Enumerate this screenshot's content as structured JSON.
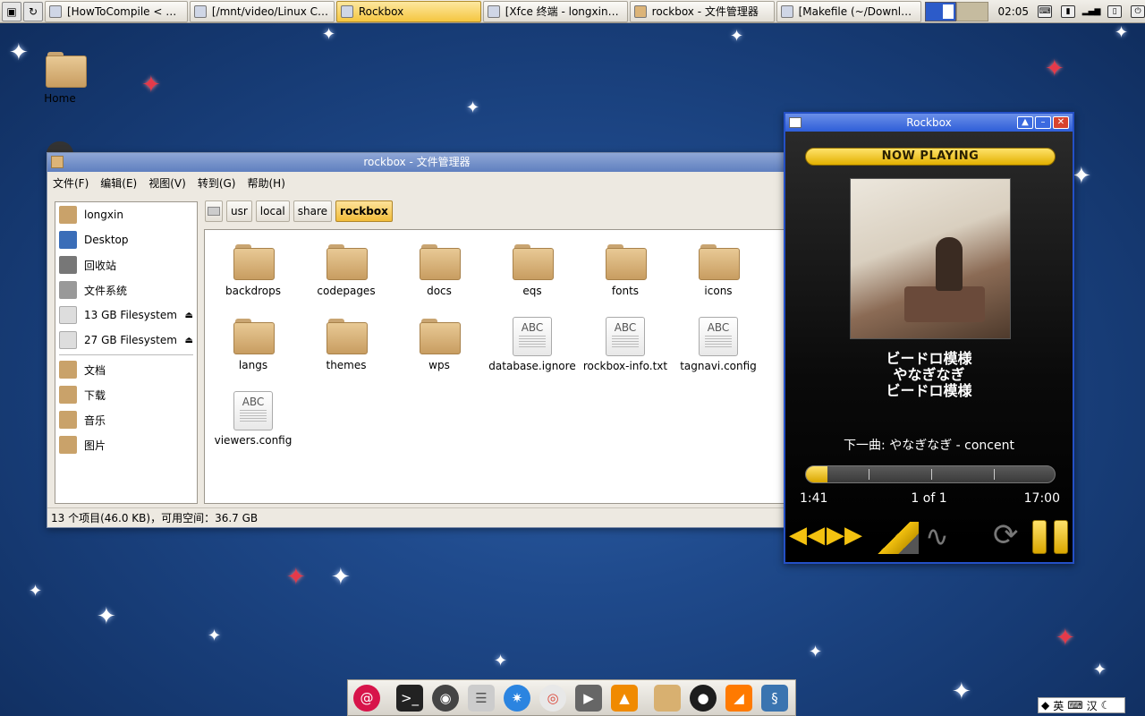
{
  "taskbar": {
    "launchers": [
      "monitor-icon",
      "reload-icon"
    ],
    "tasks": [
      {
        "label": "[HowToCompile < Ma…",
        "icon": "chrome-icon",
        "active": false
      },
      {
        "label": "[/mnt/video/Linux C…",
        "icon": "browser-icon",
        "active": false
      },
      {
        "label": "Rockbox",
        "icon": "window-icon",
        "active": true
      },
      {
        "label": "[Xfce 终端 - longxin@…",
        "icon": "terminal-icon",
        "active": false
      },
      {
        "label": "rockbox - 文件管理器",
        "icon": "folder-icon",
        "active": false
      },
      {
        "label": "[Makefile (~/Downlo…",
        "icon": "editor-icon",
        "active": false
      }
    ],
    "clock": "02:05"
  },
  "desktop": {
    "home_label": "Home"
  },
  "file_manager": {
    "title": "rockbox - 文件管理器",
    "menu": [
      "文件(F)",
      "编辑(E)",
      "视图(V)",
      "转到(G)",
      "帮助(H)"
    ],
    "sidebar": [
      {
        "label": "longxin",
        "icon": "home-folder-icon",
        "color": "#c9a26a"
      },
      {
        "label": "Desktop",
        "icon": "desktop-icon",
        "color": "#3a6db8"
      },
      {
        "label": "回收站",
        "icon": "trash-icon",
        "color": "#777"
      },
      {
        "label": "文件系统",
        "icon": "drive-icon",
        "color": "#999"
      },
      {
        "label": "13 GB Filesystem",
        "icon": "drive-icon",
        "color": "#ccc",
        "eject": true
      },
      {
        "label": "27 GB Filesystem",
        "icon": "drive-icon",
        "color": "#ccc",
        "eject": true
      },
      {
        "label": "文档",
        "icon": "documents-folder-icon",
        "color": "#c9a26a"
      },
      {
        "label": "下载",
        "icon": "downloads-folder-icon",
        "color": "#c9a26a"
      },
      {
        "label": "音乐",
        "icon": "music-folder-icon",
        "color": "#c9a26a"
      },
      {
        "label": "图片",
        "icon": "pictures-folder-icon",
        "color": "#c9a26a"
      }
    ],
    "path": [
      "usr",
      "local",
      "share",
      "rockbox"
    ],
    "files": [
      {
        "name": "backdrops",
        "type": "folder"
      },
      {
        "name": "codepages",
        "type": "folder"
      },
      {
        "name": "docs",
        "type": "folder"
      },
      {
        "name": "eqs",
        "type": "folder"
      },
      {
        "name": "fonts",
        "type": "folder"
      },
      {
        "name": "icons",
        "type": "folder"
      },
      {
        "name": "langs",
        "type": "folder"
      },
      {
        "name": "themes",
        "type": "folder"
      },
      {
        "name": "wps",
        "type": "folder"
      },
      {
        "name": "database.ignore",
        "type": "text"
      },
      {
        "name": "rockbox-info.txt",
        "type": "text"
      },
      {
        "name": "tagnavi.config",
        "type": "text"
      },
      {
        "name": "viewers.config",
        "type": "text"
      }
    ],
    "text_icon_label": "ABC",
    "status": "13 个项目(46.0 KB)，可用空间：36.7 GB"
  },
  "rockbox": {
    "title": "Rockbox",
    "now_playing": "NOW PLAYING",
    "track_title": "ビードロ模様",
    "artist": "やなぎなぎ",
    "album": "ビードロ模様",
    "next": "下一曲: やなぎなぎ - concent",
    "progress": 0.087,
    "elapsed": "1:41",
    "position": "1 of 1",
    "duration": "17:00"
  },
  "dock": [
    "debian-icon",
    "terminal-icon",
    "camera-icon",
    "file-cabinet-icon",
    "safari-icon",
    "chrome-icon",
    "media-player-icon",
    "vlc-icon",
    "folder-icon",
    "qq-icon",
    "matlab-icon",
    "python-icon"
  ],
  "ime": {
    "lang": "英",
    "mode": "汉"
  }
}
